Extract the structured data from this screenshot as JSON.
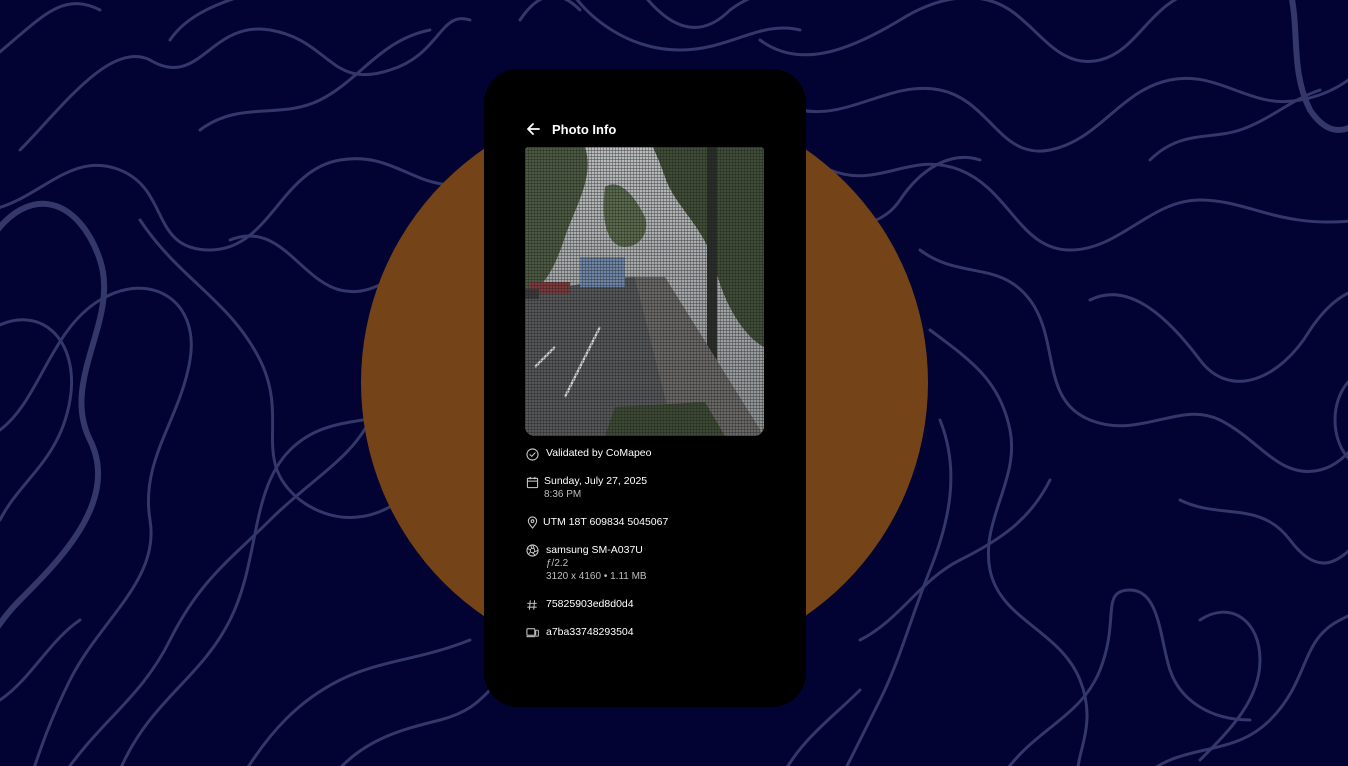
{
  "screen": {
    "title": "Photo Info",
    "back_icon": "arrow-left-icon"
  },
  "photo": {
    "description_icon": "photo-preview"
  },
  "details": {
    "validation": {
      "icon": "check-circle-icon",
      "label": "Validated by CoMapeo"
    },
    "capture_time": {
      "icon": "calendar-icon",
      "date": "Sunday, July 27, 2025",
      "time": "8:36 PM"
    },
    "location": {
      "icon": "location-pin-icon",
      "value": "UTM 18T 609834 5045067"
    },
    "camera": {
      "icon": "aperture-icon",
      "device": "samsung SM-A037U",
      "aperture": "ƒ/2.2",
      "size": "3120 x 4160 • 1.11 MB"
    },
    "hash": {
      "icon": "hash-icon",
      "value": "75825903ed8d0d4"
    },
    "device_id": {
      "icon": "devices-icon",
      "value": "a7ba33748293504"
    }
  },
  "colors": {
    "background": "#020233",
    "topo_lines": "#34376a",
    "accent_circle": "#744418",
    "phone": "#000000",
    "text": "#ffffff",
    "subtext": "#bdbdbd"
  }
}
